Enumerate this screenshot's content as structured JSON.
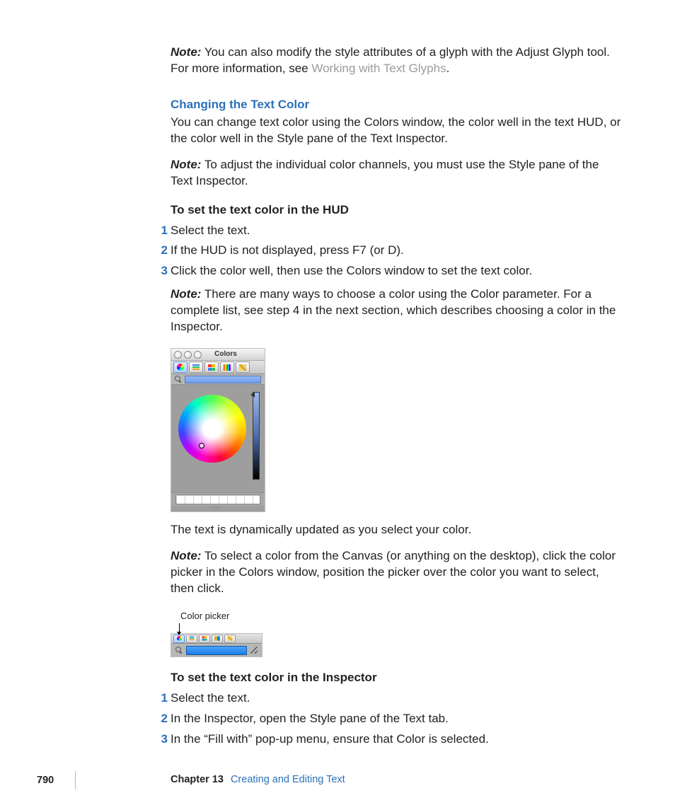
{
  "intro_note": {
    "label": "Note:",
    "text": "  You can also modify the style attributes of a glyph with the Adjust Glyph tool. For more information, see ",
    "link": "Working with Text Glyphs",
    "period": "."
  },
  "section": {
    "heading": "Changing the Text Color",
    "para1": "You can change text color using the Colors window, the color well in the text HUD, or the color well in the Style pane of the Text Inspector.",
    "note1_label": "Note:",
    "note1_text": "  To adjust the individual color channels, you must use the Style pane of the Text Inspector.",
    "hud_heading": "To set the text color in the HUD",
    "hud_steps": [
      "Select the text.",
      "If the HUD is not displayed, press F7 (or D).",
      "Click the color well, then use the Colors window to set the text color."
    ],
    "note2_label": "Note:",
    "note2_text": "  There are many ways to choose a color using the Color parameter. For a complete list, see step 4 in the next section, which describes choosing a color in the Inspector.",
    "after_fig_para": "The text is dynamically updated as you select your color.",
    "note3_label": "Note:",
    "note3_text": "  To select a color from the Canvas (or anything on the desktop), click the color picker in the Colors window, position the picker over the color you want to select, then click.",
    "callout_label": "Color picker",
    "insp_heading": "To set the text color in the Inspector",
    "insp_steps": [
      "Select the text.",
      "In the Inspector, open the Style pane of the Text tab.",
      "In the “Fill with” pop-up menu, ensure that Color is selected."
    ]
  },
  "colors_window": {
    "title": "Colors"
  },
  "footer": {
    "page": "790",
    "chapter": "Chapter 13",
    "title": "Creating and Editing Text"
  }
}
